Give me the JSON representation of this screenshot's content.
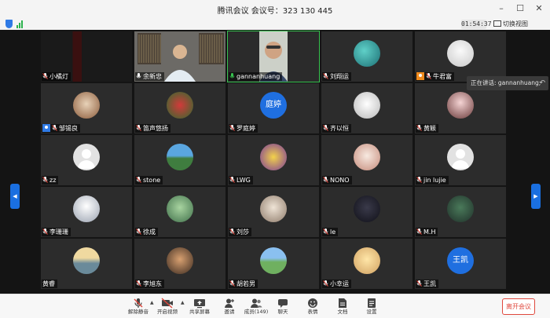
{
  "window": {
    "title": "腾讯会议  会议号：323 130 445"
  },
  "status": {
    "timer": "01:54:37",
    "switch_view": "切换视图"
  },
  "toast": {
    "text": "正在讲话: gannanhuang;"
  },
  "participants": [
    {
      "name": "小橘灯",
      "muted": true
    },
    {
      "name": "余新忠",
      "muted": false
    },
    {
      "name": "gannanhuang",
      "muted": false,
      "speaking": true
    },
    {
      "name": "刘翔运",
      "muted": true
    },
    {
      "name": "牛君富",
      "muted": true,
      "host": "orange"
    },
    {
      "name": "邹锡良",
      "muted": true,
      "host": "blue"
    },
    {
      "name": "笛声悠扬",
      "muted": true
    },
    {
      "name": "罗庭婷",
      "muted": true,
      "avatar_text": "庭婷"
    },
    {
      "name": "齐以恒",
      "muted": true
    },
    {
      "name": "黄颖",
      "muted": true
    },
    {
      "name": "zz",
      "muted": true
    },
    {
      "name": "stone",
      "muted": true
    },
    {
      "name": "LWG",
      "muted": true
    },
    {
      "name": "NONO",
      "muted": true
    },
    {
      "name": "jin lujie",
      "muted": true
    },
    {
      "name": "李珊珊",
      "muted": true
    },
    {
      "name": "徐成",
      "muted": true
    },
    {
      "name": "刘莎",
      "muted": true
    },
    {
      "name": "le",
      "muted": true
    },
    {
      "name": "M.H",
      "muted": true
    },
    {
      "name": "黄睿",
      "muted": false,
      "no_icon": true
    },
    {
      "name": "李旭东",
      "muted": true
    },
    {
      "name": "胡若男",
      "muted": true
    },
    {
      "name": "小幸运",
      "muted": true
    },
    {
      "name": "王凯",
      "muted": true,
      "avatar_text": "王凯"
    }
  ],
  "toolbar": {
    "unmute": "解除静音",
    "video": "开启视频",
    "share": "共享屏幕",
    "invite": "邀请",
    "members": "成员(149)",
    "chat": "聊天",
    "reactions": "表情",
    "docs": "文档",
    "settings": "设置",
    "leave": "离开会议"
  },
  "colors": {
    "accent": "#1a6fe0",
    "speaking": "#37c24f",
    "leave": "#e0483d"
  }
}
